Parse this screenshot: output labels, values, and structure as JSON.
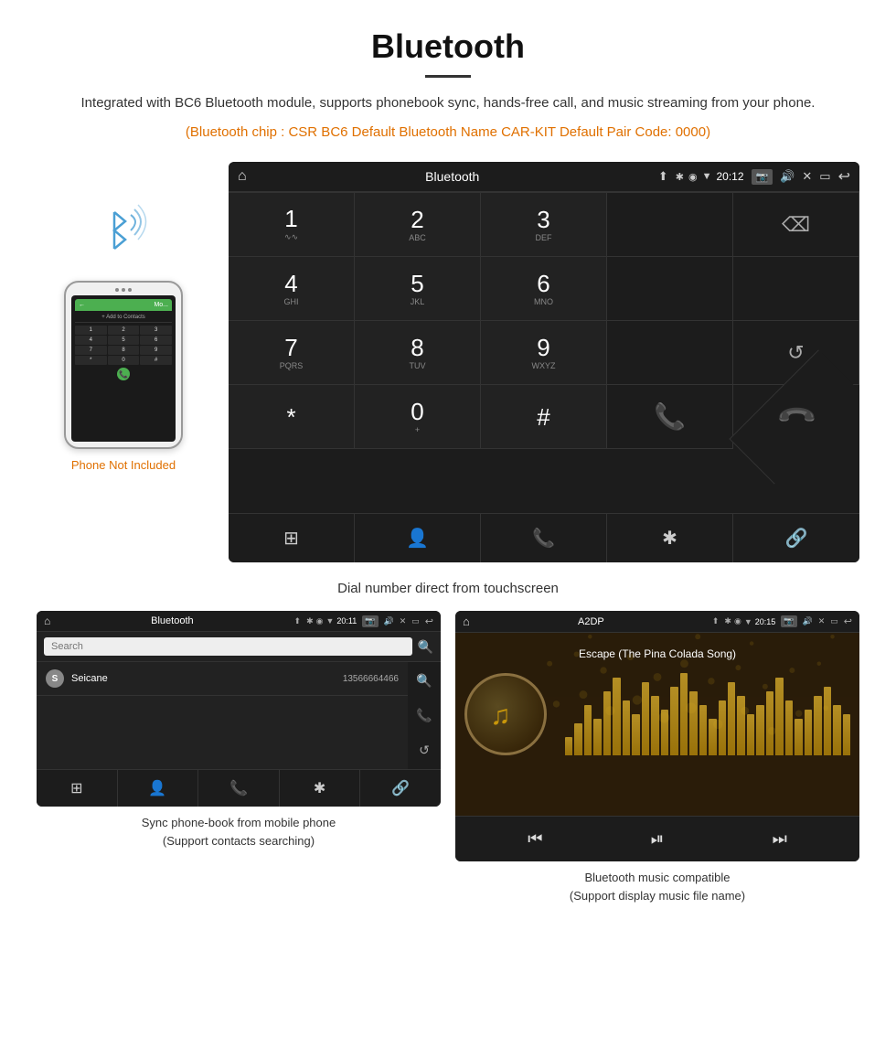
{
  "page": {
    "title": "Bluetooth",
    "divider": true,
    "description": "Integrated with BC6 Bluetooth module, supports phonebook sync, hands-free call, and music streaming from your phone.",
    "specs": "(Bluetooth chip : CSR BC6    Default Bluetooth Name CAR-KIT    Default Pair Code: 0000)",
    "dial_caption": "Dial number direct from touchscreen",
    "phonebook_caption": "Sync phone-book from mobile phone\n(Support contacts searching)",
    "music_caption": "Bluetooth music compatible\n(Support display music file name)"
  },
  "dial_screen": {
    "status_bar": {
      "title": "Bluetooth",
      "time": "20:12",
      "usb_icon": "⬆",
      "bluetooth_icon": "✱",
      "location_icon": "◉",
      "wifi_icon": "▼",
      "battery_icon": "▌"
    },
    "keys": [
      {
        "num": "1",
        "letters": "∿∿"
      },
      {
        "num": "2",
        "letters": "ABC"
      },
      {
        "num": "3",
        "letters": "DEF"
      },
      {
        "num": "",
        "letters": ""
      },
      {
        "num": "⌫",
        "letters": ""
      },
      {
        "num": "4",
        "letters": "GHI"
      },
      {
        "num": "5",
        "letters": "JKL"
      },
      {
        "num": "6",
        "letters": "MNO"
      },
      {
        "num": "",
        "letters": ""
      },
      {
        "num": "",
        "letters": ""
      },
      {
        "num": "7",
        "letters": "PQRS"
      },
      {
        "num": "8",
        "letters": "TUV"
      },
      {
        "num": "9",
        "letters": "WXYZ"
      },
      {
        "num": "",
        "letters": ""
      },
      {
        "num": "↺",
        "letters": ""
      },
      {
        "num": "*",
        "letters": ""
      },
      {
        "num": "0",
        "letters": "+"
      },
      {
        "num": "#",
        "letters": ""
      },
      {
        "num": "📞",
        "letters": ""
      },
      {
        "num": "📞",
        "letters": "end"
      }
    ],
    "nav_items": [
      "⊞",
      "👤",
      "📞",
      "✱",
      "🔗"
    ]
  },
  "phonebook_screen": {
    "title": "Bluetooth",
    "time": "20:11",
    "search_placeholder": "Search",
    "contact": {
      "letter": "S",
      "name": "Seicane",
      "number": "13566664466"
    },
    "side_icons": [
      "🔍",
      "📞",
      "↺"
    ],
    "bottom_icons": [
      "⊞",
      "👤",
      "📞",
      "✱",
      "🔗"
    ]
  },
  "music_screen": {
    "title": "A2DP",
    "time": "20:15",
    "song_title": "Escape (The Pina Colada Song)",
    "controls": [
      "⏮",
      "⏯",
      "⏭"
    ],
    "eq_bars": [
      20,
      35,
      55,
      40,
      70,
      85,
      60,
      45,
      80,
      65,
      50,
      75,
      90,
      70,
      55,
      40,
      60,
      80,
      65,
      45,
      55,
      70,
      85,
      60,
      40,
      50,
      65,
      75,
      55,
      45
    ]
  },
  "phone_mockup": {
    "not_included_text": "Phone Not Included",
    "keys": [
      "1",
      "2",
      "3",
      "4",
      "5",
      "6",
      "7",
      "8",
      "9",
      "*",
      "0",
      "#"
    ]
  }
}
